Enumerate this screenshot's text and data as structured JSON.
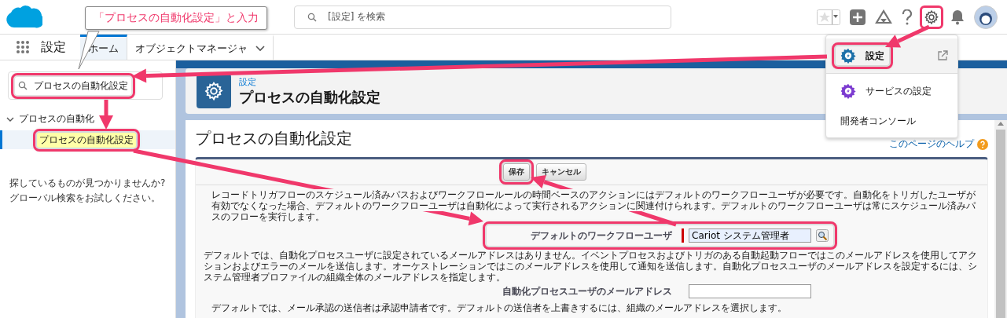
{
  "header": {
    "search_placeholder": "[設定] を検索"
  },
  "nav": {
    "app_name": "設定",
    "tabs": [
      {
        "label": "ホーム",
        "selected": true,
        "kind": "plain"
      },
      {
        "label": "オブジェクトマネージャ",
        "selected": false,
        "kind": "dropdown"
      }
    ]
  },
  "sidebar": {
    "search_value": "プロセスの自動化設定",
    "search_highlighted": true,
    "tree": [
      {
        "label": "プロセスの自動化",
        "expanded": true,
        "children": [
          {
            "label": "プロセスの自動化設定",
            "selected": true,
            "highlighted": true
          }
        ]
      }
    ],
    "hint_lines": [
      "探しているものが見つかりませんか?",
      "グローバル検索をお試しください。"
    ]
  },
  "page_header": {
    "breadcrumb": "設定",
    "title": "プロセスの自動化設定"
  },
  "content": {
    "title": "プロセスの自動化設定",
    "help_link": "このページのヘルプ",
    "buttons": [
      {
        "label": "保存",
        "highlighted": true
      },
      {
        "label": "キャンセル",
        "highlighted": false
      }
    ],
    "sections": [
      {
        "kind": "text",
        "indent": true,
        "text": "レコードトリガフローのスケジュール済みパスおよびワークフロールールの時間ベースのアクションにはデフォルトのワークフローユーザが必要です。自動化をトリガしたユーザが有効でなくなった場合、デフォルトのワークフローユーザは自動化によって実行されるアクションに関連付けられます。デフォルトのワークフローユーザは常にスケジュール済みパスのフローを実行します。"
      },
      {
        "kind": "field",
        "label": "デフォルトのワークフローユーザ",
        "value": "Cariot システム管理者",
        "required": true,
        "lookup": true,
        "highlighted": true
      },
      {
        "kind": "text",
        "indent": false,
        "text": "デフォルトでは、自動化プロセスユーザに設定されているメールアドレスはありません。イベントプロセスおよびトリガのある自動起動フローではこのメールアドレスを使用してアクションおよびエラーのメールを送信します。オーケストレーションではこのメールアドレスを使用して通知を送信します。自動化プロセスユーザのメールアドレスを設定するには、システム管理者プロファイルの組織全体のメールアドレスを指定します。"
      },
      {
        "kind": "field",
        "label": "自動化プロセスユーザのメールアドレス",
        "required": false,
        "lookup": false,
        "highlighted": false
      },
      {
        "kind": "text",
        "indent": true,
        "text": "デフォルトでは、メール承認の送信者は承認申請者です。デフォルトの送信者を上書きするには、組織のメールアドレスを選択します。"
      }
    ]
  },
  "setup_menu": {
    "items": [
      {
        "label": "設定",
        "kind": "setup",
        "highlighted": true
      },
      {
        "label": "サービスの設定",
        "kind": "service",
        "highlighted": false
      },
      {
        "label": "開発者コンソール",
        "kind": "plain",
        "highlighted": false
      }
    ]
  },
  "callout": {
    "text": "「プロセスの自動化設定」と入力"
  }
}
